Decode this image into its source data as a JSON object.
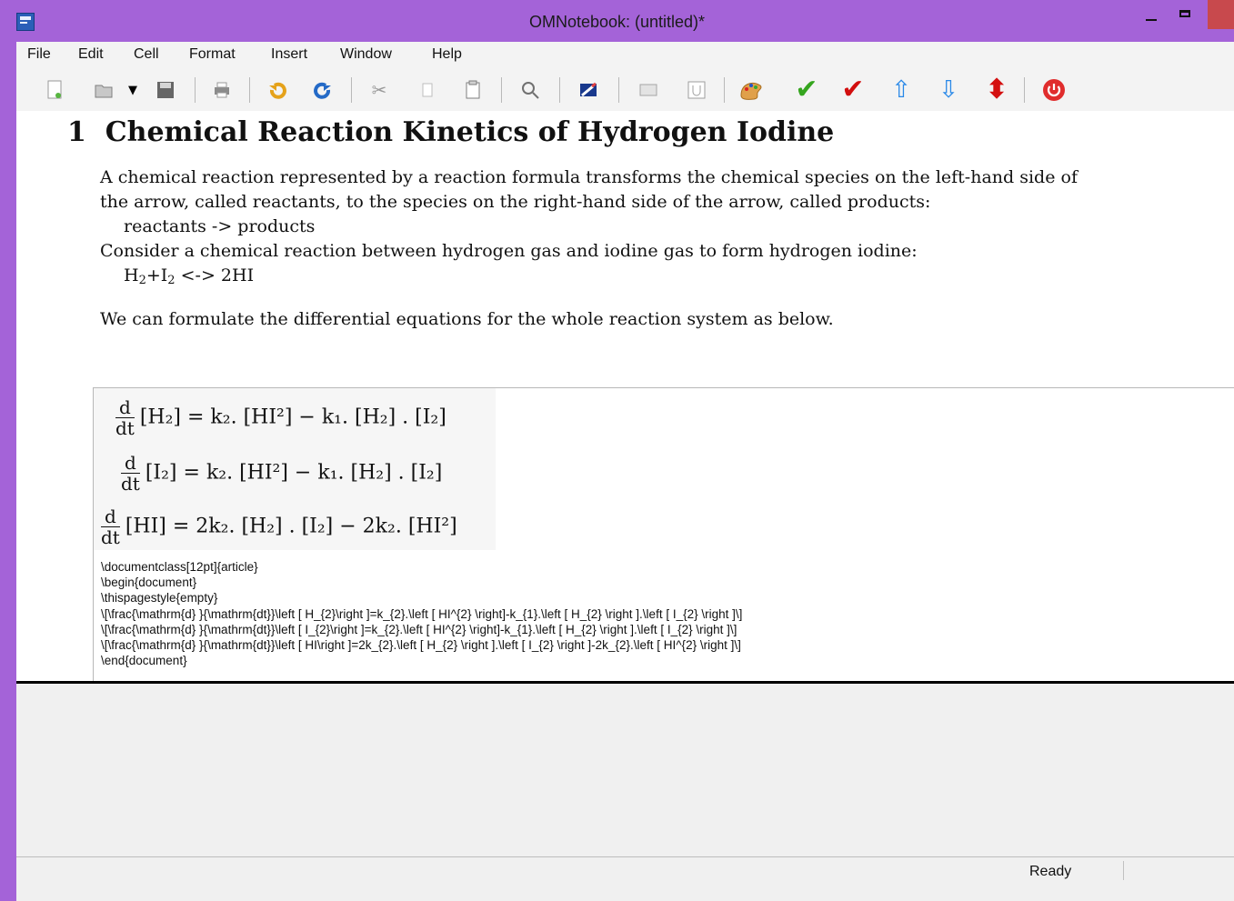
{
  "window": {
    "title": "OMNotebook: (untitled)*",
    "controls": {
      "minimize": "–",
      "maximize": "□",
      "close": "×"
    }
  },
  "menu": [
    "File",
    "Edit",
    "Cell",
    "Format",
    "Insert",
    "Window",
    "Help"
  ],
  "toolbar": {
    "icons": [
      "new-document-icon",
      "open-icon",
      "dropdown-arrow-icon",
      "save-icon",
      "print-icon",
      "undo-icon",
      "redo-icon",
      "cut-icon",
      "copy-icon",
      "paste-icon",
      "search-icon",
      "edit-cell-icon",
      "grouped-cell-icon",
      "text-cell-icon",
      "paint-icon",
      "check-icon",
      "check-red-icon",
      "arrow-up-icon",
      "arrow-down-icon",
      "double-arrow-icon",
      "power-icon"
    ]
  },
  "document": {
    "section_number": "1",
    "section_title": "Chemical Reaction Kinetics of Hydrogen Iodine",
    "paragraph1": "A chemical reaction represented by a reaction formula transforms the chemical species on the left-hand side of the arrow, called reactants, to the species on the right-hand side of the arrow, called products:",
    "reactants_line": "reactants -> products",
    "paragraph2": "Consider a chemical reaction between hydrogen gas and iodine gas to form hydrogen iodine:",
    "reaction": {
      "h": "H",
      "h_sub": "2",
      "plus": "+",
      "i": "I",
      "i_sub": "2",
      "rest": " <-> 2HI"
    },
    "paragraph3": "We can formulate the differential equations for the whole reaction system as below."
  },
  "equations": {
    "frac_num": "d",
    "frac_den": "dt",
    "eq1": "[H₂] = k₂. [HI²] − k₁. [H₂] . [I₂]",
    "eq2": "[I₂] = k₂. [HI²] − k₁. [H₂] . [I₂]",
    "eq3": "[HI] = 2k₂. [H₂] . [I₂] − 2k₂. [HI²]"
  },
  "latex_source": [
    "\\documentclass[12pt]{article}",
    "\\begin{document}",
    "\\thispagestyle{empty}",
    "\\[\\frac{\\mathrm{d} }{\\mathrm{dt}}\\left [ H_{2}\\right ]=k_{2}.\\left [ HI^{2} \\right]-k_{1}.\\left [ H_{2} \\right ].\\left [ I_{2} \\right ]\\]",
    "\\[\\frac{\\mathrm{d} }{\\mathrm{dt}}\\left [ I_{2}\\right ]=k_{2}.\\left [ HI^{2} \\right]-k_{1}.\\left [ H_{2} \\right ].\\left [ I_{2} \\right ]\\]",
    "\\[\\frac{\\mathrm{d} }{\\mathrm{dt}}\\left [ HI\\right ]=2k_{2}.\\left [ H_{2} \\right ].\\left [ I_{2} \\right ]-2k_{2}.\\left [ HI^{2} \\right ]\\]",
    "\\end{document}"
  ],
  "status": "Ready"
}
